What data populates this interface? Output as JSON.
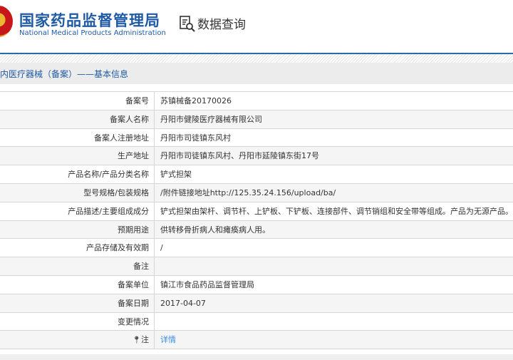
{
  "header": {
    "title_cn": "国家药品监督管理局",
    "title_en": "National Medical Products Administration",
    "query_label": "数据查询"
  },
  "section_title": "境内医疗器械（备案）——基本信息",
  "rows": [
    {
      "label": "备案号",
      "value": "苏镇械备20170026"
    },
    {
      "label": "备案人名称",
      "value": "丹阳市健陵医疗器械有限公司"
    },
    {
      "label": "备案人注册地址",
      "value": "丹阳市司徒镇东风村"
    },
    {
      "label": "生产地址",
      "value": "丹阳市司徒镇东风村、丹阳市延陵镇东街17号"
    },
    {
      "label": "产品名称/产品分类名称",
      "value": "铲式担架"
    },
    {
      "label": "型号规格/包装规格",
      "value": "/附件链接地址http://125.35.24.156/upload/ba/"
    },
    {
      "label": "产品描述/主要组成成分",
      "value": "铲式担架由架杆、调节杆、上铲板、下铲板、连接部件、调节销组和安全带等组成。产品为无源产品。"
    },
    {
      "label": "预期用途",
      "value": "供转移骨折病人和瘫痪病人用。"
    },
    {
      "label": "产品存储及有效期",
      "value": "/"
    },
    {
      "label": "备注",
      "value": ""
    },
    {
      "label": "备案单位",
      "value": "镇江市食品药品监督管理局"
    },
    {
      "label": "备案日期",
      "value": "2017-04-07"
    },
    {
      "label": "变更情况",
      "value": ""
    }
  ],
  "note": {
    "label": "注",
    "link": "详情"
  }
}
